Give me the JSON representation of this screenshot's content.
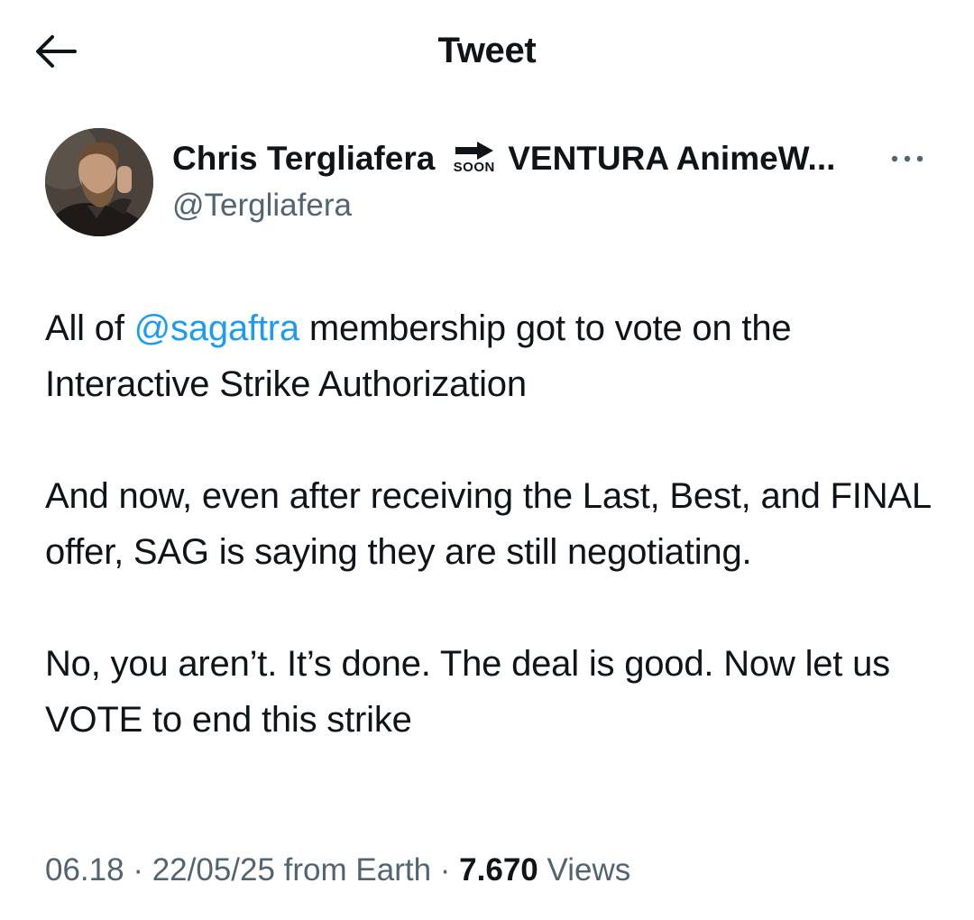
{
  "header": {
    "title": "Tweet",
    "back_icon": "arrow-left-icon"
  },
  "author": {
    "display_name": "Chris Tergliafera",
    "badge_text": "SOON",
    "badge_icon": "arrow-right-icon",
    "name_suffix": "VENTURA AnimeW...",
    "handle": "@Tergliafera",
    "more_icon": "more-horizontal-icon"
  },
  "tweet": {
    "para1": {
      "before": "All of ",
      "mention": "@sagaftra",
      "after": " membership got to vote on the Interactive Strike Authorization"
    },
    "para2": "And now, even after receiving the Last, Best, and FINAL offer, SAG is saying they are still negotiating.",
    "para3": "No, you aren’t. It’s done. The deal is good. Now let us VOTE to end this strike"
  },
  "meta": {
    "time": "06.18",
    "separator": " · ",
    "date": "22/05/25",
    "source": " from Earth",
    "views_count": "7.670",
    "views_label": " Views"
  },
  "colors": {
    "text": "#0f1419",
    "secondary": "#536471",
    "link": "#1d9bf0",
    "background": "#ffffff"
  }
}
